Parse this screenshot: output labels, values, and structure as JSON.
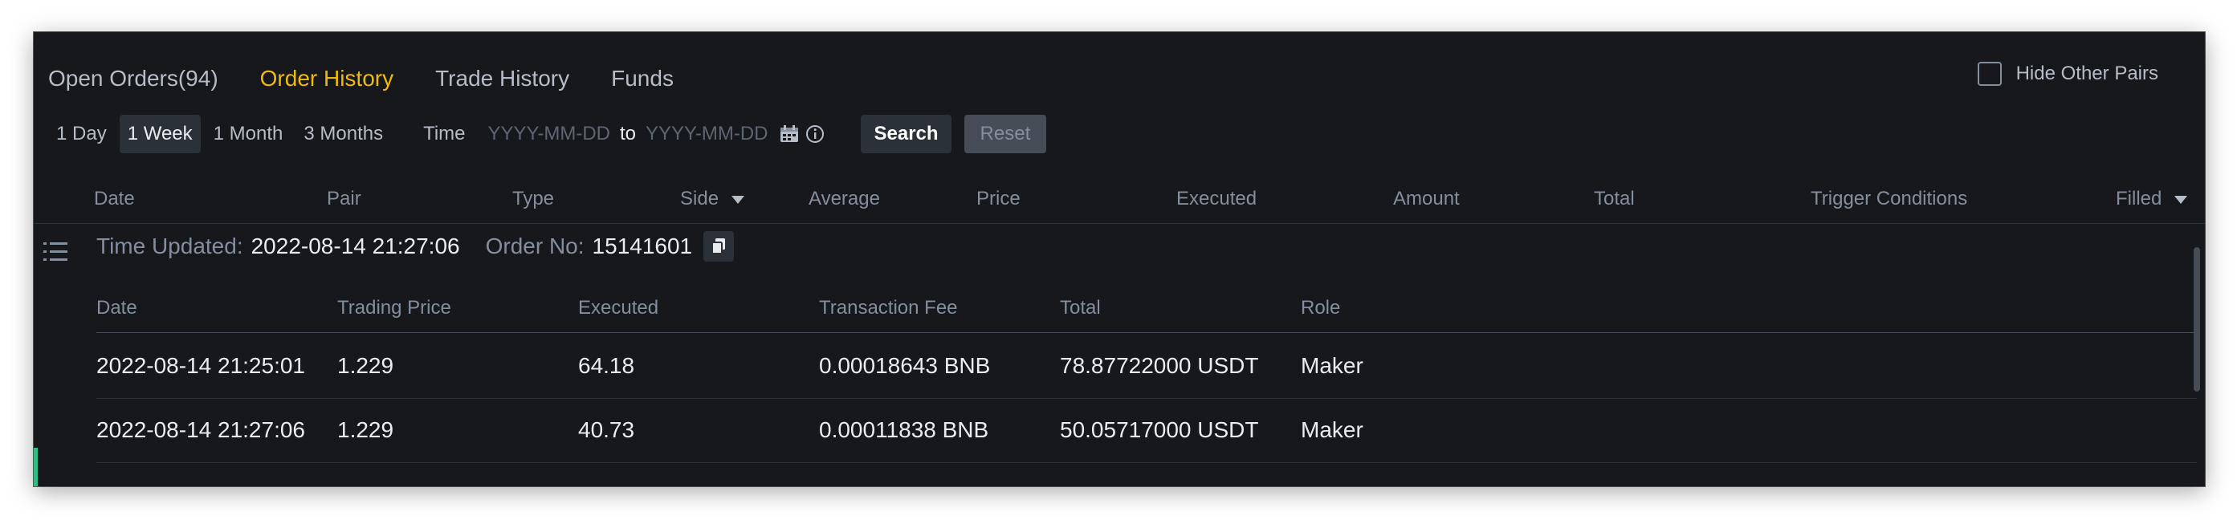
{
  "tabs": [
    {
      "label": "Open Orders(94)"
    },
    {
      "label": "Order History"
    },
    {
      "label": "Trade History"
    },
    {
      "label": "Funds"
    }
  ],
  "hide_other_pairs": {
    "label": "Hide Other Pairs",
    "checked": false
  },
  "filters": {
    "periods": [
      {
        "label": "1 Day"
      },
      {
        "label": "1 Week"
      },
      {
        "label": "1 Month"
      },
      {
        "label": "3 Months"
      }
    ],
    "active_period": "1 Week",
    "time_label": "Time",
    "start_placeholder": "YYYY-MM-DD",
    "to_label": "to",
    "end_placeholder": "YYYY-MM-DD",
    "search_label": "Search",
    "reset_label": "Reset"
  },
  "columns": {
    "date": "Date",
    "pair": "Pair",
    "type": "Type",
    "side": "Side",
    "average": "Average",
    "price": "Price",
    "executed": "Executed",
    "amount": "Amount",
    "total": "Total",
    "trigger": "Trigger Conditions",
    "filled": "Filled"
  },
  "detail": {
    "time_updated_label": "Time Updated:",
    "time_updated_value": "2022-08-14 21:27:06",
    "order_no_label": "Order No:",
    "order_no_value": "15141601",
    "headers": {
      "date": "Date",
      "trading_price": "Trading Price",
      "executed": "Executed",
      "fee": "Transaction Fee",
      "total": "Total",
      "role": "Role"
    },
    "trades": [
      {
        "date": "2022-08-14 21:25:01",
        "trading_price": "1.229",
        "executed": "64.18",
        "fee": "0.00018643 BNB",
        "total": "78.87722000 USDT",
        "role": "Maker"
      },
      {
        "date": "2022-08-14 21:27:06",
        "trading_price": "1.229",
        "executed": "40.73",
        "fee": "0.00011838 BNB",
        "total": "50.05717000 USDT",
        "role": "Maker"
      }
    ]
  },
  "colors": {
    "accent": "#f0b90b",
    "background": "#16181c",
    "text": "#eaecef",
    "muted": "#848e9c",
    "positive": "#2ebd85"
  },
  "icons": [
    "calendar-icon",
    "info-icon",
    "copy-icon",
    "list-icon",
    "caret-down-icon"
  ]
}
